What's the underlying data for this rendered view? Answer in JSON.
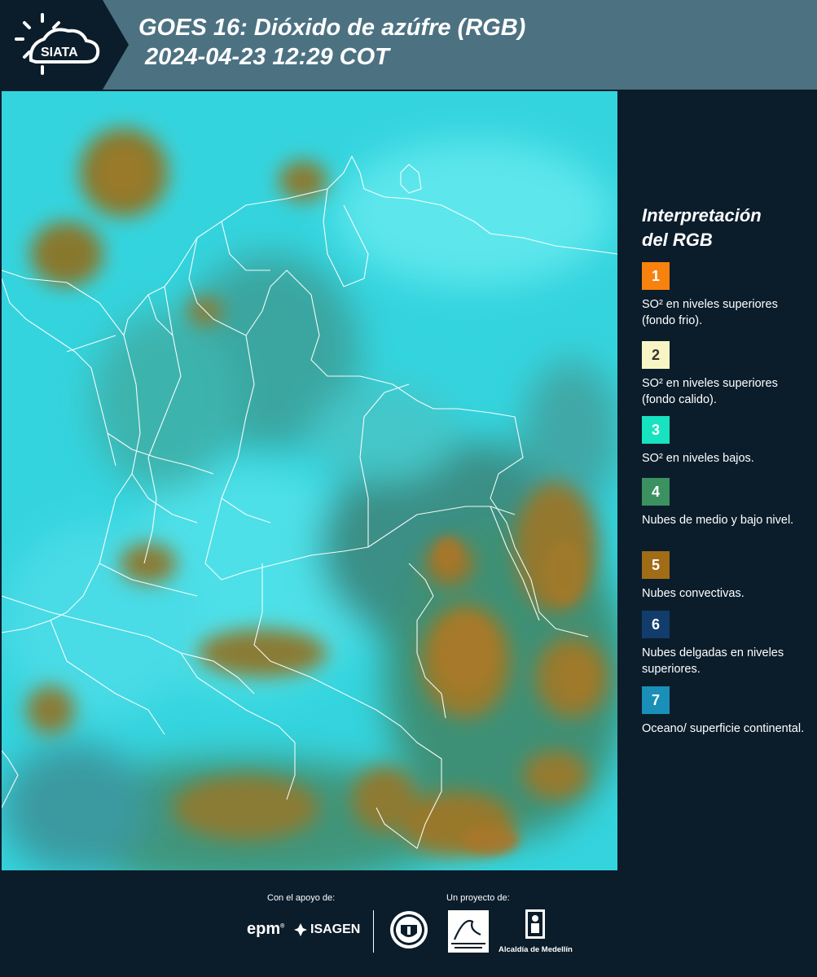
{
  "header": {
    "logo_text": "SIATA",
    "title_line1": "GOES 16: Dióxido de azúfre (RGB)",
    "title_line2": "2024-04-23 12:29 COT"
  },
  "legend": {
    "title_line1": "Interpretación",
    "title_line2": "del RGB",
    "items": [
      {
        "number": "1",
        "color": "#f7820e",
        "label": "SO² en niveles superiores (fondo frio)."
      },
      {
        "number": "2",
        "color": "#f8f5c4",
        "label": "SO² en niveles superiores (fondo calido)."
      },
      {
        "number": "3",
        "color": "#17e3c1",
        "label": "SO² en niveles bajos."
      },
      {
        "number": "4",
        "color": "#3c9160",
        "label": "Nubes de medio y bajo nivel."
      },
      {
        "number": "5",
        "color": "#a16c16",
        "label": "Nubes convectivas."
      },
      {
        "number": "6",
        "color": "#123c6b",
        "label": "Nubes delgadas en niveles superiores."
      },
      {
        "number": "7",
        "color": "#1a8fb8",
        "label": "Oceano/ superficie continental."
      }
    ]
  },
  "footer": {
    "support_label": "Con el apoyo de:",
    "project_label": "Un proyecto de:",
    "sponsor_1": "epm",
    "sponsor_2": "ISAGEN",
    "partner_1": "Área Metropolitana Valle de Aburrá",
    "partner_2": "Alcaldía de Medellín"
  }
}
